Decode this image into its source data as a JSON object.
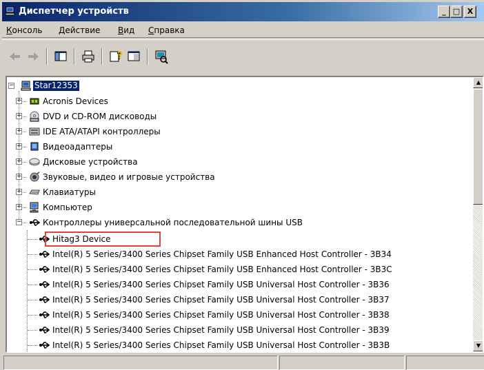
{
  "window": {
    "title": "Диспетчер устройств",
    "caption_buttons": {
      "minimize": "_",
      "maximize": "□",
      "close": "X"
    }
  },
  "menu": [
    {
      "label": "Консоль",
      "mnemonic": "К",
      "rest": "онсоль"
    },
    {
      "label": "Действие",
      "mnemonic": "Д",
      "rest": "ействие"
    },
    {
      "label": "Вид",
      "mnemonic": "В",
      "rest": "ид"
    },
    {
      "label": "Справка",
      "mnemonic": "С",
      "rest": "правка"
    }
  ],
  "toolbar": {
    "buttons": [
      "back-arrow-icon",
      "forward-arrow-icon",
      "show-hide-tree-icon",
      "print-icon",
      "help-icon",
      "properties-icon",
      "scan-hardware-icon"
    ]
  },
  "tree": {
    "root": {
      "label": "Star12353",
      "selected": true,
      "icon": "computer-icon"
    },
    "categories": [
      {
        "label": "Acronis Devices",
        "icon": "chip-icon",
        "expanded": false
      },
      {
        "label": "DVD и CD-ROM дисководы",
        "icon": "cd-drive-icon",
        "expanded": false
      },
      {
        "label": "IDE ATA/ATAPI контроллеры",
        "icon": "ide-controller-icon",
        "expanded": false
      },
      {
        "label": "Видеоадаптеры",
        "icon": "display-adapter-icon",
        "expanded": false
      },
      {
        "label": "Дисковые устройства",
        "icon": "disk-drive-icon",
        "expanded": false
      },
      {
        "label": "Звуковые, видео и игровые устройства",
        "icon": "sound-icon",
        "expanded": false
      },
      {
        "label": "Клавиатуры",
        "icon": "keyboard-icon",
        "expanded": false
      },
      {
        "label": "Компьютер",
        "icon": "computer-icon",
        "expanded": false
      },
      {
        "label": "Контроллеры универсальной последовательной шины USB",
        "icon": "usb-icon",
        "expanded": true
      }
    ],
    "usb_devices": [
      {
        "label": "Hitag3 Device",
        "highlighted": true
      },
      {
        "label": "Intel(R) 5 Series/3400 Series Chipset Family USB Enhanced Host Controller - 3B34"
      },
      {
        "label": "Intel(R) 5 Series/3400 Series Chipset Family USB Enhanced Host Controller - 3B3C"
      },
      {
        "label": "Intel(R) 5 Series/3400 Series Chipset Family USB Universal Host Controller - 3B36"
      },
      {
        "label": "Intel(R) 5 Series/3400 Series Chipset Family USB Universal Host Controller - 3B37"
      },
      {
        "label": "Intel(R) 5 Series/3400 Series Chipset Family USB Universal Host Controller - 3B38"
      },
      {
        "label": "Intel(R) 5 Series/3400 Series Chipset Family USB Universal Host Controller - 3B39"
      },
      {
        "label": "Intel(R) 5 Series/3400 Series Chipset Family USB Universal Host Controller - 3B3B"
      }
    ]
  },
  "colors": {
    "title_active": "#0a246a",
    "selection": "#0a246a",
    "highlight_box": "#e0443c",
    "face": "#d4d0c8"
  }
}
